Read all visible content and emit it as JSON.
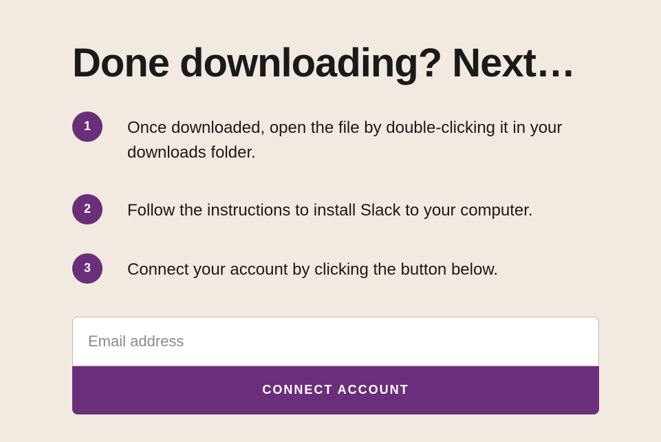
{
  "heading": "Done downloading? Next…",
  "steps": [
    {
      "number": "1",
      "text": "Once downloaded, open the file by double-clicking it in your downloads folder."
    },
    {
      "number": "2",
      "text": "Follow the instructions to install Slack to your computer."
    },
    {
      "number": "3",
      "text": "Connect your account by clicking the button below."
    }
  ],
  "form": {
    "email_placeholder": "Email address",
    "button_label": "CONNECT ACCOUNT"
  },
  "colors": {
    "background": "#f2eae0",
    "accent": "#6b2e7a"
  }
}
